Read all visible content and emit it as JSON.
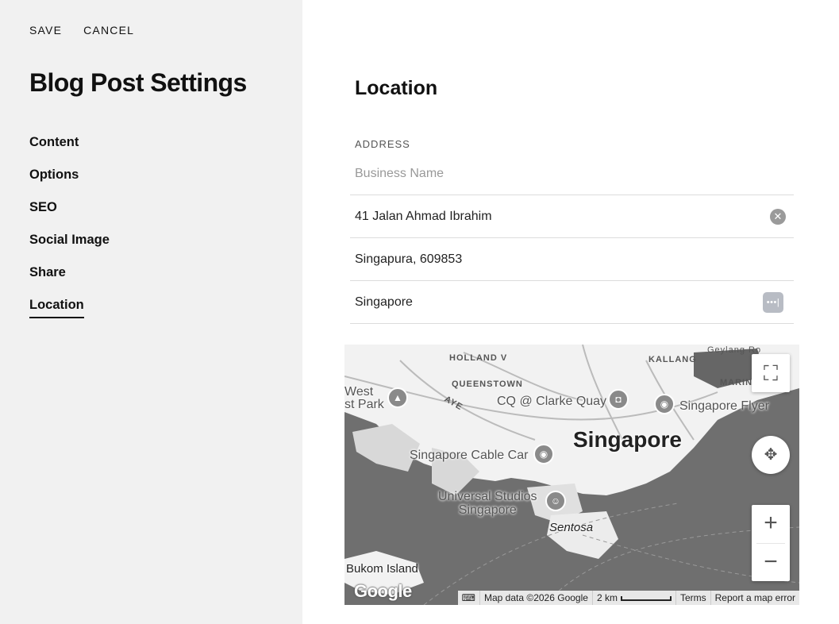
{
  "header": {
    "save_label": "SAVE",
    "cancel_label": "CANCEL"
  },
  "sidebar": {
    "title": "Blog Post Settings",
    "items": [
      {
        "label": "Content"
      },
      {
        "label": "Options"
      },
      {
        "label": "SEO"
      },
      {
        "label": "Social Image"
      },
      {
        "label": "Share"
      },
      {
        "label": "Location",
        "active": true
      }
    ]
  },
  "location": {
    "title": "Location",
    "address_label": "ADDRESS",
    "business_name": {
      "value": "",
      "placeholder": "Business Name"
    },
    "street": {
      "value": "41 Jalan Ahmad Ibrahim"
    },
    "city_postal": {
      "value": "Singapura, 609853"
    },
    "country": {
      "value": "Singapore"
    }
  },
  "map": {
    "labels": {
      "holland": "HOLLAND V",
      "queenstown": "QUEENSTOWN",
      "kallang": "KALLANG",
      "marina": "MARIN",
      "geylang": "Geylang Ro",
      "west_park": "West\nst Park",
      "clarke_quay": "CQ @ Clarke Quay",
      "flyer": "Singapore Flyer",
      "city": "Singapore",
      "cable_car": "Singapore Cable Car",
      "universal": "Universal Studios\nSingapore",
      "sentosa": "Sentosa",
      "bukom": "Bukom Island",
      "ave": "AYE"
    },
    "google": "Google",
    "attribution": {
      "map_data": "Map data ©2026 Google",
      "scale": "2 km",
      "terms": "Terms",
      "report": "Report a map error"
    },
    "colors": {
      "water": "#6f6f6f",
      "land": "#f2f2f2"
    }
  }
}
